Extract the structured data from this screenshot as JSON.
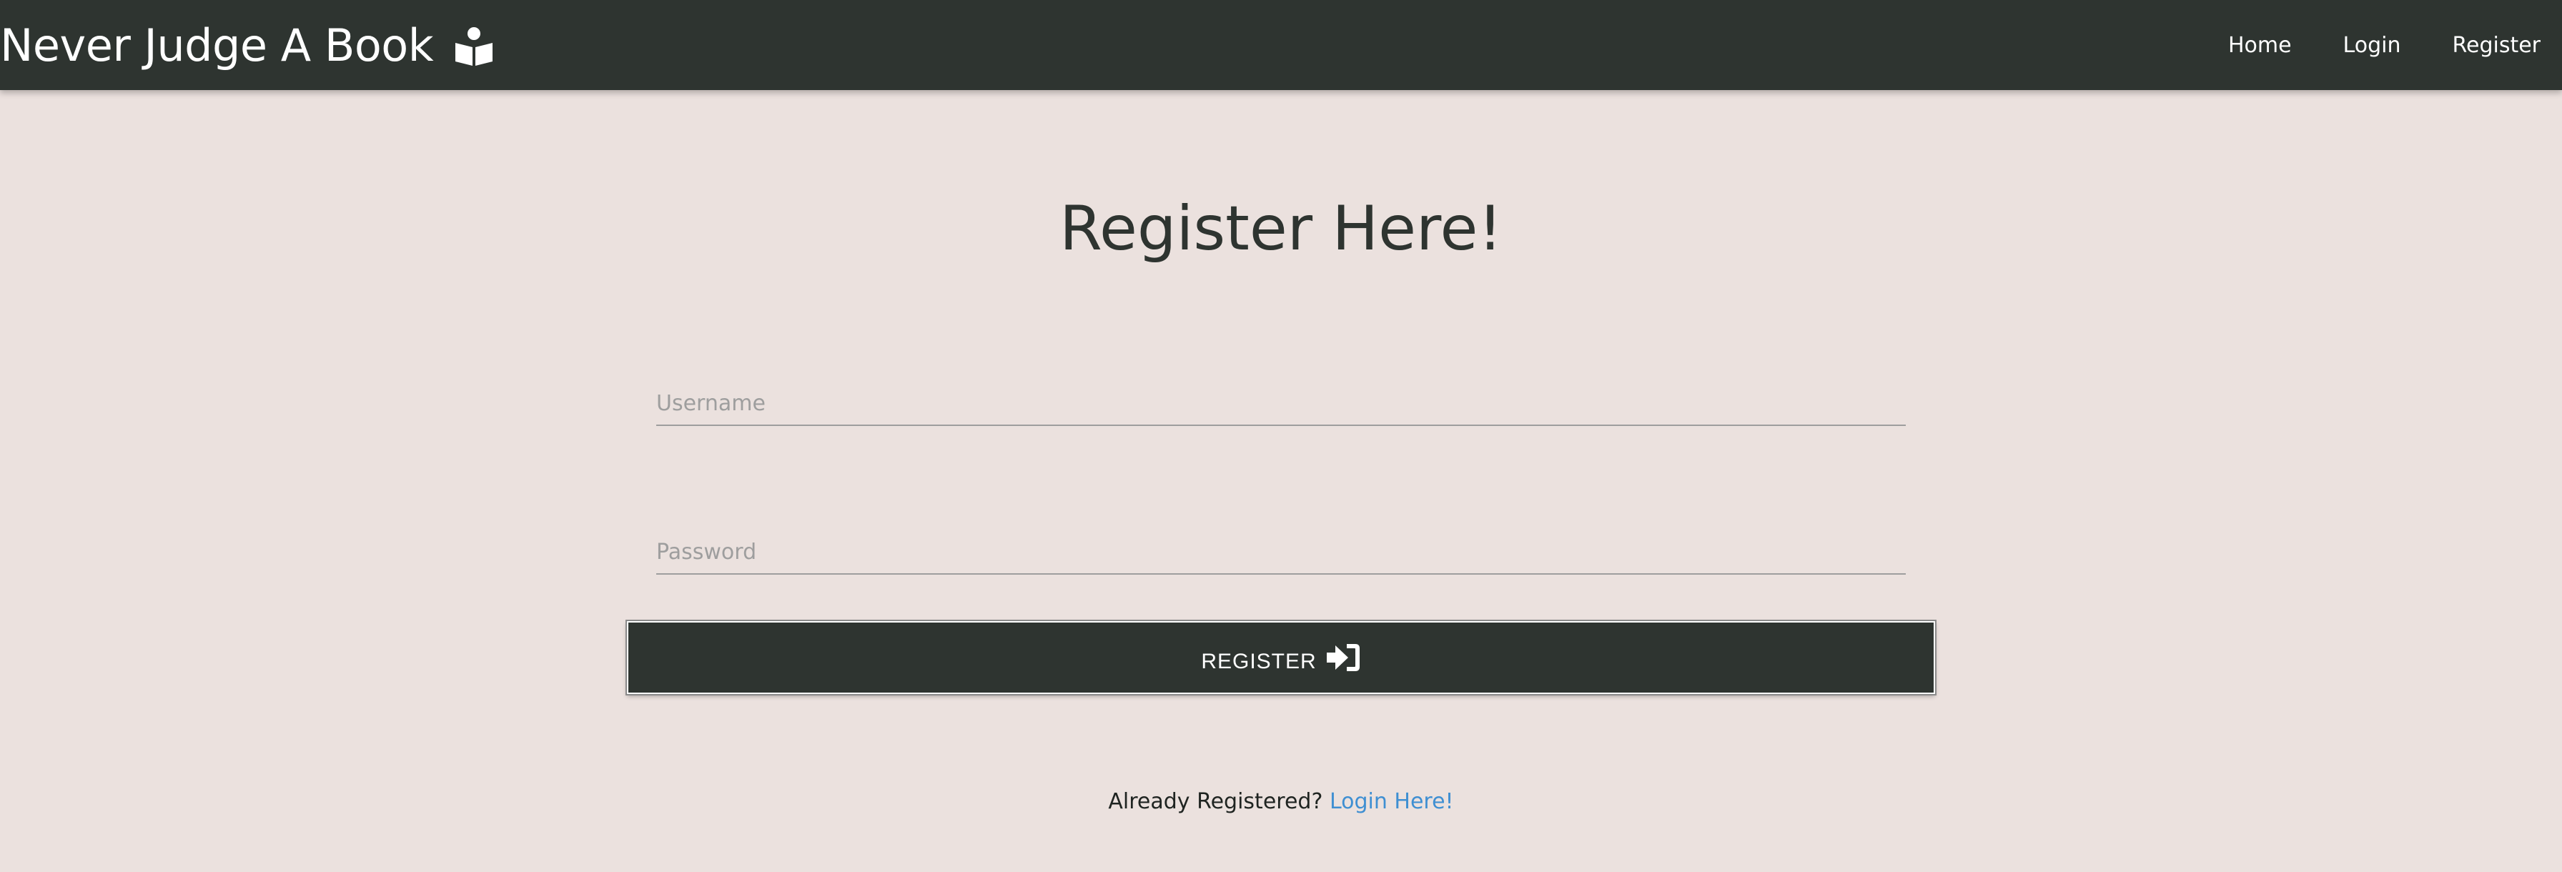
{
  "navbar": {
    "brand": "Never Judge A Book",
    "brand_icon": "book-reader-icon",
    "links": [
      {
        "label": "Home"
      },
      {
        "label": "Login"
      },
      {
        "label": "Register"
      }
    ]
  },
  "main": {
    "title": "Register Here!",
    "username": {
      "placeholder": "Username",
      "value": ""
    },
    "password": {
      "placeholder": "Password",
      "value": ""
    },
    "submit_label": "REGISTER",
    "submit_icon": "sign-in-icon",
    "footer_prompt": "Already Registered?",
    "footer_link": "Login Here!"
  },
  "colors": {
    "background": "#ebe1de",
    "navbar": "#2e3430",
    "link": "#3f8fd2"
  }
}
